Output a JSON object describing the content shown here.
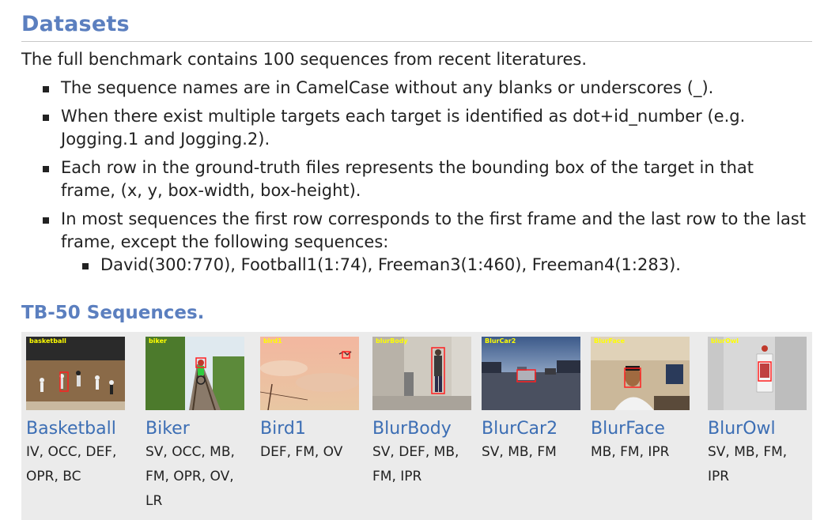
{
  "datasets": {
    "title": "Datasets",
    "intro": "The full benchmark contains 100 sequences from recent literatures.",
    "bullets": [
      "The sequence names are in CamelCase without any blanks or underscores (_).",
      "When there exist multiple targets each target is identified as dot+id_number (e.g. Jogging.1 and Jogging.2).",
      "Each row in the ground-truth files represents the bounding box of the target in that frame, (x, y, box-width, box-height).",
      "In most sequences the first row corresponds to the first frame and the last row to the last frame, except the following sequences:"
    ],
    "sub_bullet": "David(300:770), Football1(1:74), Freeman3(1:460), Freeman4(1:283)."
  },
  "tb50": {
    "title": "TB-50 Sequences.",
    "sequences": [
      {
        "name": "Basketball",
        "tag": "basketball",
        "attrs": "IV, OCC, DEF, OPR, BC"
      },
      {
        "name": "Biker",
        "tag": "biker",
        "attrs": "SV, OCC, MB, FM, OPR, OV, LR"
      },
      {
        "name": "Bird1",
        "tag": "bird1",
        "attrs": "DEF, FM, OV"
      },
      {
        "name": "BlurBody",
        "tag": "blurBody",
        "attrs": "SV, DEF, MB, FM, IPR"
      },
      {
        "name": "BlurCar2",
        "tag": "BlurCar2",
        "attrs": "SV, MB, FM"
      },
      {
        "name": "BlurFace",
        "tag": "BlurFace",
        "attrs": "MB, FM, IPR"
      },
      {
        "name": "BlurOwl",
        "tag": "blurOwl",
        "attrs": "SV, MB, FM, IPR"
      }
    ]
  },
  "colors": {
    "heading": "#5b7fbf",
    "link": "#3c6eb4",
    "gallery_bg": "#ebebeb",
    "bbox": "#ff2020"
  }
}
